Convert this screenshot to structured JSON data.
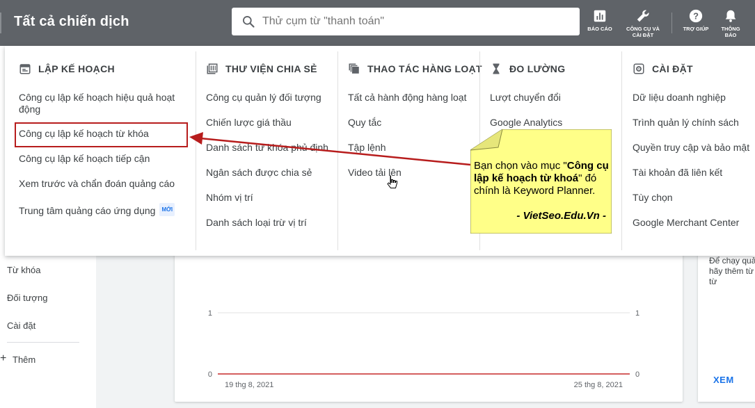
{
  "header": {
    "title": "Tất cả chiến dịch",
    "search_placeholder": "Thử cụm từ \"thanh toán\"",
    "tools": [
      {
        "icon": "bar-chart-icon",
        "label": "BÁO CÁO"
      },
      {
        "icon": "wrench-icon",
        "label": "CÔNG CỤ VÀ CÀI ĐẶT"
      },
      {
        "icon": "help-icon",
        "label": "TRỢ GIÚP"
      },
      {
        "icon": "bell-icon",
        "label": "THÔNG BÁO"
      }
    ]
  },
  "left_nav": {
    "items": [
      "Từ khóa",
      "Đối tượng",
      "Cài đặt"
    ],
    "more": "Thêm"
  },
  "menu": {
    "columns": [
      {
        "heading": "LẬP KẾ HOẠCH",
        "icon": "calendar-icon",
        "items": [
          "Công cụ lập kế hoạch hiệu quả hoạt động",
          "Công cụ lập kế hoạch từ khóa",
          "Công cụ lập kế hoạch tiếp cận",
          "Xem trước và chẩn đoán quảng cáo",
          "Trung tâm quảng cáo ứng dụng"
        ],
        "badge": "MỚI"
      },
      {
        "heading": "THƯ VIỆN CHIA SẺ",
        "icon": "library-icon",
        "items": [
          "Công cụ quản lý đối tượng",
          "Chiến lược giá thầu",
          "Danh sách từ khóa phủ định",
          "Ngân sách được chia sẻ",
          "Nhóm vị trí",
          "Danh sách loại trừ vị trí"
        ]
      },
      {
        "heading": "THAO TÁC HÀNG LOẠT",
        "icon": "bulk-actions-icon",
        "items": [
          "Tất cả hành động hàng loạt",
          "Quy tắc",
          "Tập lệnh",
          "Video tải lên"
        ]
      },
      {
        "heading": "ĐO LƯỜNG",
        "icon": "hourglass-icon",
        "items": [
          "Lượt chuyển đổi",
          "Google Analytics"
        ]
      },
      {
        "heading": "CÀI ĐẶT",
        "icon": "settings-icon",
        "items": [
          "Dữ liệu doanh nghiệp",
          "Trình quản lý chính sách",
          "Quyền truy cập và bảo mật",
          "Tài khoản đã liên kết",
          "Tùy chọn",
          "Google Merchant Center"
        ]
      }
    ]
  },
  "chart": {
    "y_ticks": [
      "1",
      "0"
    ],
    "x_labels": [
      "19 thg 8, 2021",
      "25 thg 8, 2021"
    ]
  },
  "side_card": {
    "text": "Để chạy quảng cáo, hãy thêm từ khóa vào từ",
    "link": "XEM"
  },
  "annotation": {
    "lead": "Bạn chọn vào mục \"",
    "bold": "Công cụ lập kế hoạch từ khoá",
    "tail": "\" đó chính là Keyword Planner.",
    "signature": "- VietSeo.Edu.Vn -"
  },
  "colors": {
    "header_bg": "#5f6368",
    "highlight": "#b71c1c",
    "note_bg": "#ffff88",
    "link_blue": "#1a73e8"
  }
}
